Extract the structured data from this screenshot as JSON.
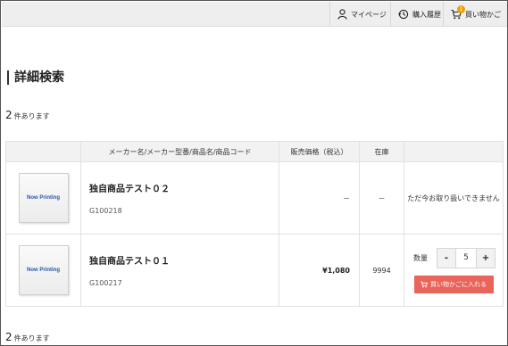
{
  "header": {
    "mypage_label": "マイページ",
    "history_label": "購入履歴",
    "cart_label": "買い物かご",
    "cart_count": "1"
  },
  "page": {
    "title": "詳細検索"
  },
  "result_count": {
    "number": "2",
    "suffix": "件あります"
  },
  "table": {
    "headers": [
      "",
      "メーカー名/メーカー型番/商品名/商品コード",
      "販売価格（税込）",
      "在庫",
      ""
    ],
    "rows": [
      {
        "image_text": "Now Printing",
        "name": "独自商品テスト０２",
        "code": "G100218",
        "price": "－",
        "stock": "－",
        "action": "ただ今お取り扱いできません"
      },
      {
        "image_text": "Now Printing",
        "name": "独自商品テスト０１",
        "code": "G100217",
        "price": "¥1,080",
        "stock": "9994",
        "qty_label": "数量",
        "qty_minus": "-",
        "qty_value": "5",
        "qty_plus": "+",
        "cart_button": "買い物かごに入れる"
      }
    ]
  },
  "colors": {
    "accent": "#e96459",
    "badge": "#f0a000",
    "header_bg": "#eeeeee"
  }
}
